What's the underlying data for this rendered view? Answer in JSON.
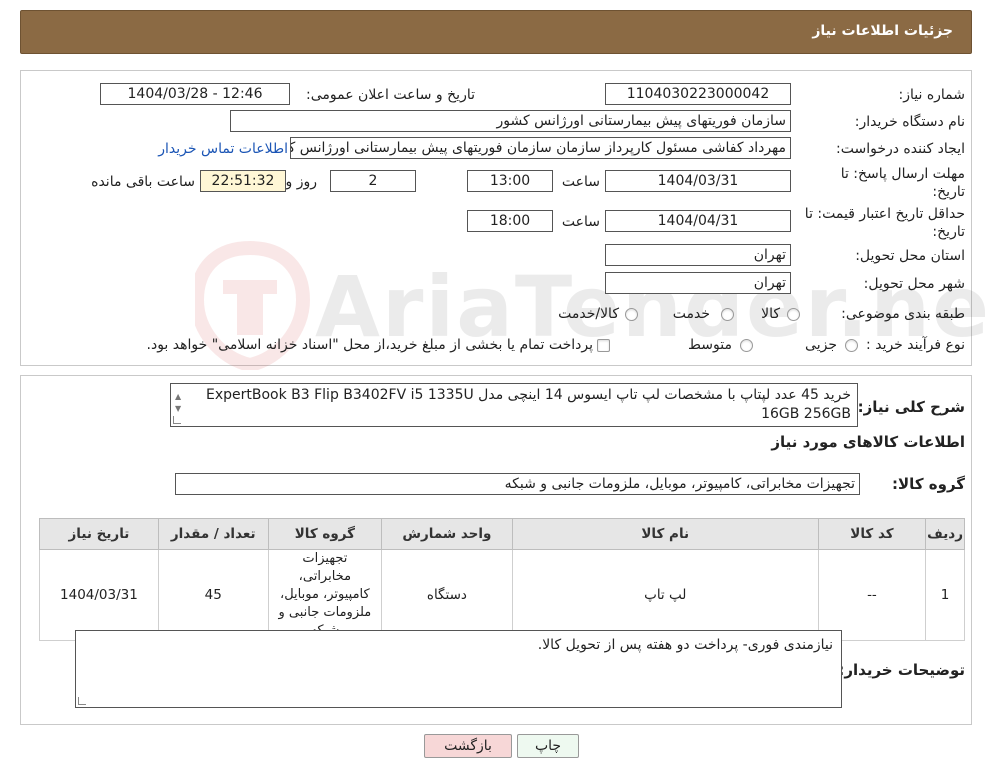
{
  "header": {
    "title": "جزئیات اطلاعات نیاز"
  },
  "watermark": {
    "text": "AriaTender.neT"
  },
  "form": {
    "need_number_label": "شماره نیاز:",
    "need_number": "1104030223000042",
    "announce_label": "تاریخ و ساعت اعلان عمومی:",
    "announce_value": "1404/03/28 - 12:46",
    "buyer_org_label": "نام دستگاه خریدار:",
    "buyer_org": "سازمان فوریتهای پیش بیمارستانی اورژانس کشور",
    "creator_label": "ایجاد کننده درخواست:",
    "creator": "مهرداد کفاشی مسئول کارپرداز سازمان سازمان فوریتهای پیش بیمارستانی اورژانس کشور",
    "contact_link": "اطلاعات تماس خریدار",
    "deadline_label_1": "مهلت ارسال پاسخ: تا",
    "deadline_label_2": "تاریخ:",
    "deadline_date": "1404/03/31",
    "hour_label": "ساعت",
    "deadline_time": "13:00",
    "days_value": "2",
    "days_label": "روز و",
    "remaining_time": "22:51:32",
    "remaining_label": "ساعت باقی مانده",
    "validity_label_1": "حداقل تاریخ اعتبار قیمت: تا",
    "validity_label_2": "تاریخ:",
    "validity_date": "1404/04/31",
    "validity_time": "18:00",
    "province_label": "استان محل تحویل:",
    "province": "تهران",
    "city_label": "شهر محل تحویل:",
    "city": "تهران",
    "category_label": "طبقه بندی موضوعی:",
    "category_options": [
      "کالا",
      "خدمت",
      "کالا/خدمت"
    ],
    "process_label": "نوع فرآیند خرید :",
    "process_options": [
      "جزیی",
      "متوسط"
    ],
    "process_note": "پرداخت تمام یا بخشی از مبلغ خرید،از محل \"اسناد خزانه اسلامی\" خواهد بود."
  },
  "details": {
    "summary_label": "شرح کلی نیاز:",
    "summary_text": "خرید 45 عدد لپتاپ با مشخصات لپ تاپ ایسوس 14 اینچی مدل ExpertBook B3 Flip B3402FV i5 1335U 16GB 256GB",
    "items_title": "اطلاعات کالاهای مورد نیاز",
    "group_label": "گروه کالا:",
    "group_value": "تجهیزات مخابراتی، کامپیوتر، موبایل، ملزومات جانبی و شبکه",
    "table": {
      "headers": [
        "ردیف",
        "کد کالا",
        "نام کالا",
        "واحد شمارش",
        "گروه کالا",
        "تعداد / مقدار",
        "تاریخ نیاز"
      ],
      "rows": [
        [
          "1",
          "--",
          "لپ تاپ",
          "دستگاه",
          "تجهیزات مخابراتی، کامپیوتر، موبایل، ملزومات جانبی و شبکه",
          "45",
          "1404/03/31"
        ]
      ]
    },
    "buyer_notes_label": "توضیحات خریدار:",
    "buyer_notes": "نیازمندی فوری- پرداخت دو هفته پس از تحویل کالا."
  },
  "buttons": {
    "print": "چاپ",
    "back": "بازگشت"
  },
  "colors": {
    "header_bg": "#8b6a44",
    "link": "#1b55b5",
    "back_bg": "#f7d7d7",
    "print_bg": "#eef9f0"
  }
}
